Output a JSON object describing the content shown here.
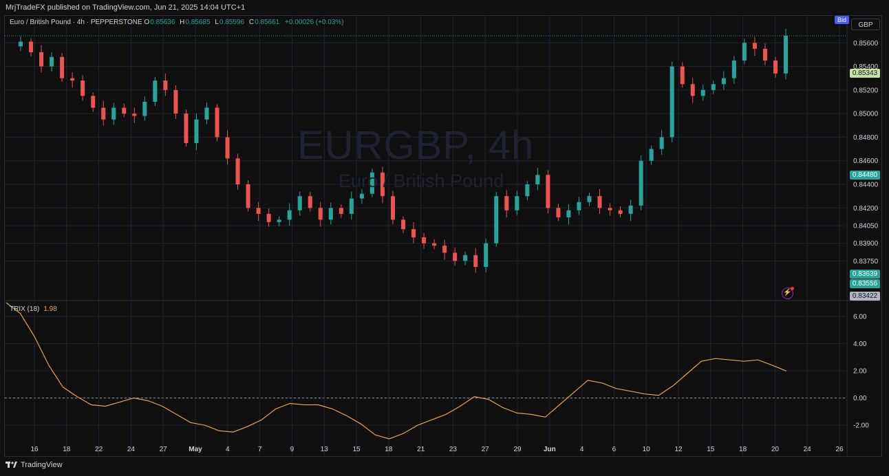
{
  "header": {
    "published": "MrjTradeFX published on TradingView.com, Jun 21, 2025 14:04 UTC+1"
  },
  "legend": {
    "symbol": "Euro / British Pound · 4h · PEPPERSTONE",
    "o_label": "O",
    "o_value": "0.85636",
    "h_label": "H",
    "h_value": "0.85685",
    "l_label": "L",
    "l_value": "0.85596",
    "c_label": "C",
    "c_value": "0.85661",
    "change": "+0.00026 (+0.03%)"
  },
  "watermark": {
    "ticker": "EURGBP, 4h",
    "name": "Euro / British Pound"
  },
  "currency": "GBP",
  "bid_label": "Bid",
  "trix_legend": {
    "name": "TRIX (18)",
    "value": "1.98"
  },
  "price_badges": [
    {
      "text": "0.85343",
      "value": 0.85343,
      "bg": "#c5e1a5",
      "fg": "#131722"
    },
    {
      "text": "0.84480",
      "value": 0.8448,
      "bg": "#26a69a",
      "fg": "#ffffff"
    },
    {
      "text": "0.83639",
      "value": 0.83639,
      "bg": "#26a69a",
      "fg": "#ffffff"
    },
    {
      "text": "0.83556",
      "value": 0.83556,
      "bg": "#26a69a",
      "fg": "#ffffff"
    },
    {
      "text": "0.83422",
      "value": 0.83422,
      "bg": "#b2b5be",
      "fg": "#131722"
    }
  ],
  "footer": {
    "brand": "TradingView"
  },
  "colors": {
    "up": "#26a69a",
    "down": "#ef5350",
    "trix": "#e5a35b",
    "grid": "#1e2130",
    "text": "#d1d4dc"
  },
  "chart_data": [
    {
      "type": "candlestick",
      "title": "EURGBP, 4h",
      "ylim": [
        0.8342,
        0.8573
      ],
      "y_ticks": [
        "0.85600",
        "0.85400",
        "0.85200",
        "0.85000",
        "0.84800",
        "0.84600",
        "0.84400",
        "0.84200",
        "0.84050",
        "0.83900",
        "0.83750"
      ],
      "x_ticks": [
        "16",
        "18",
        "22",
        "24",
        "27",
        "May",
        "4",
        "7",
        "9",
        "13",
        "15",
        "18",
        "21",
        "23",
        "27",
        "29",
        "Jun",
        "4",
        "6",
        "10",
        "12",
        "15",
        "18",
        "20",
        "24",
        "26"
      ],
      "grid": true,
      "series": [
        {
          "name": "close",
          "values": [
            0.8561,
            0.8552,
            0.854,
            0.8548,
            0.853,
            0.8528,
            0.8515,
            0.8505,
            0.8495,
            0.8505,
            0.85,
            0.8498,
            0.851,
            0.8528,
            0.852,
            0.85,
            0.8475,
            0.8495,
            0.8505,
            0.848,
            0.8462,
            0.844,
            0.842,
            0.8415,
            0.8408,
            0.841,
            0.8418,
            0.843,
            0.842,
            0.841,
            0.842,
            0.8415,
            0.8428,
            0.8432,
            0.845,
            0.843,
            0.841,
            0.8402,
            0.8395,
            0.839,
            0.8388,
            0.8382,
            0.8375,
            0.838,
            0.837,
            0.839,
            0.843,
            0.8418,
            0.843,
            0.844,
            0.8448,
            0.842,
            0.8412,
            0.8418,
            0.8425,
            0.843,
            0.842,
            0.8418,
            0.8415,
            0.8422,
            0.846,
            0.847,
            0.848,
            0.854,
            0.8525,
            0.8515,
            0.852,
            0.8525,
            0.853,
            0.8545,
            0.856,
            0.8555,
            0.8545,
            0.8534,
            0.8566
          ]
        }
      ]
    },
    {
      "type": "line",
      "title": "TRIX (18)",
      "ylim": [
        -3.2,
        7.0
      ],
      "y_ticks": [
        "6.00",
        "4.00",
        "2.00",
        "0.00",
        "-2.00"
      ],
      "zero_line": true,
      "series": [
        {
          "name": "TRIX (18)",
          "values": [
            7.0,
            6.2,
            4.5,
            2.4,
            0.8,
            0.1,
            -0.5,
            -0.6,
            -0.3,
            0.0,
            -0.2,
            -0.6,
            -1.2,
            -1.8,
            -2.0,
            -2.4,
            -2.5,
            -2.1,
            -1.6,
            -0.8,
            -0.4,
            -0.5,
            -0.5,
            -0.8,
            -1.3,
            -1.9,
            -2.7,
            -3.0,
            -2.6,
            -2.0,
            -1.6,
            -1.2,
            -0.6,
            0.1,
            -0.1,
            -0.7,
            -1.1,
            -1.2,
            -1.4,
            -0.5,
            0.4,
            1.3,
            1.1,
            0.7,
            0.5,
            0.3,
            0.2,
            0.9,
            1.8,
            2.7,
            2.9,
            2.8,
            2.7,
            2.8,
            2.4,
            1.98
          ]
        }
      ]
    }
  ]
}
